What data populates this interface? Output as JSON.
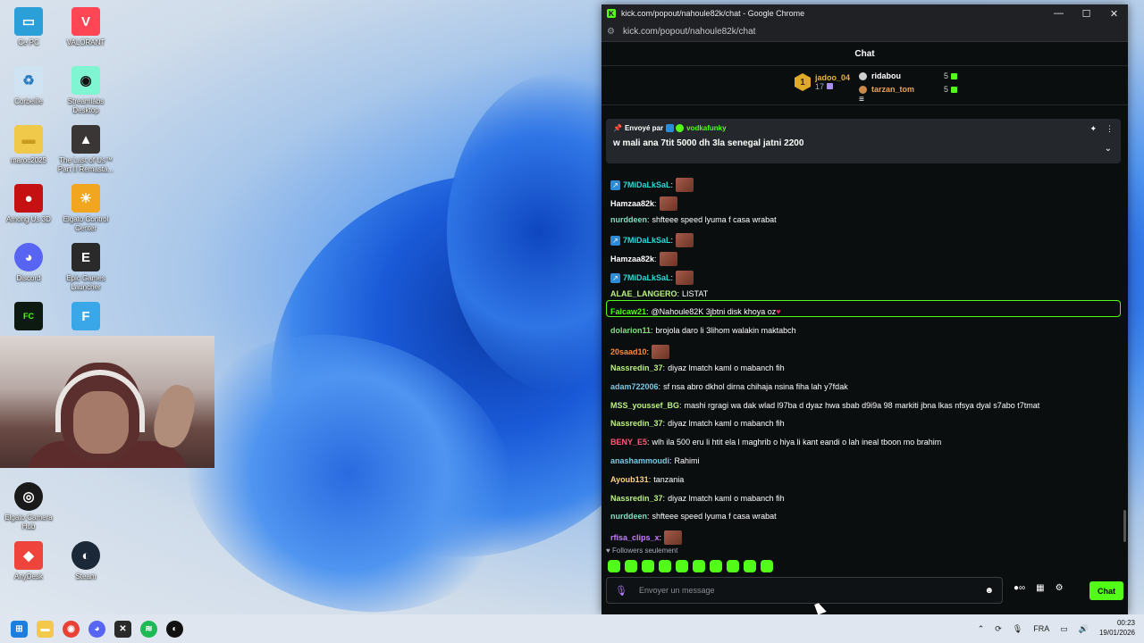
{
  "desktop_icons": [
    {
      "label": "Ce PC",
      "color": "#2a9fd8",
      "glyph": "▭"
    },
    {
      "label": "VALORANT",
      "color": "#ff4655",
      "glyph": "V"
    },
    {
      "label": "Corbeille",
      "color": "#cfe3f3",
      "glyph": "♻"
    },
    {
      "label": "Streamlabs Desktop",
      "color": "#80f5d2",
      "glyph": "◉"
    },
    {
      "label": "maroc2025",
      "color": "#f0c84a",
      "glyph": "▬"
    },
    {
      "label": "The Last of Us™ Part II Remasta...",
      "color": "#3b3636",
      "glyph": "▲"
    },
    {
      "label": "Among Us 3D",
      "color": "#c51111",
      "glyph": "●"
    },
    {
      "label": "Elgato Control Center",
      "color": "#f2a51e",
      "glyph": "☀"
    },
    {
      "label": "Discord",
      "color": "#5865f2",
      "glyph": "◕"
    },
    {
      "label": "Epic Games Launcher",
      "color": "#2a2a2a",
      "glyph": "E"
    },
    {
      "label": "Elgato Camera Hub",
      "color": "#1a1a1a",
      "glyph": "◎"
    },
    {
      "label": "AnyDesk",
      "color": "#ef443b",
      "glyph": "◆"
    },
    {
      "label": "Steam",
      "color": "#1b2838",
      "glyph": "◐"
    }
  ],
  "browser": {
    "title": "kick.com/popout/nahoule82k/chat - Google Chrome",
    "url": "kick.com/popout/nahoule82k/chat",
    "minimize": "—",
    "maximize": "☐",
    "close": "✕"
  },
  "chat": {
    "header": "Chat",
    "leaderboard": {
      "first": {
        "rank": "1",
        "name": "jadoo_04",
        "count": "17"
      },
      "second": {
        "name": "ridabou",
        "count": "5"
      },
      "third": {
        "name": "tarzan_tom",
        "count": "5"
      }
    },
    "pinned": {
      "sent_by_label": "Envoyé par",
      "sender": "vodkafunky",
      "message": "w mali ana 7tit 5000 dh 3la senegal jatni 2200"
    },
    "messages": [
      {
        "user": "7MiDaLkSaL",
        "color": "#2bd9d9",
        "text": "",
        "badge": true,
        "emote": true
      },
      {
        "user": "Hamzaa82k",
        "color": "#ffffff",
        "text": "",
        "badge": false,
        "emote": true
      },
      {
        "user": "nurddeen",
        "color": "#7ee0c2",
        "text": "shfteee speed lyuma f casa wrabat",
        "badge": false,
        "emote": false
      },
      {
        "user": "7MiDaLkSaL",
        "color": "#2bd9d9",
        "text": "",
        "badge": true,
        "emote": true
      },
      {
        "user": "Hamzaa82k",
        "color": "#ffffff",
        "text": "",
        "badge": false,
        "emote": true
      },
      {
        "user": "7MiDaLkSaL",
        "color": "#2bd9d9",
        "text": "",
        "badge": true,
        "emote": true
      },
      {
        "user": "ALAE_LANGERO",
        "color": "#b9f27c",
        "text": "LISTAT",
        "badge": false,
        "emote": false
      },
      {
        "user": "Falcaw21",
        "color": "#53fc18",
        "text": "@Nahoule82K 3jbtni disk khoya oz",
        "badge": false,
        "emote": false,
        "heart": true
      },
      {
        "user": "dolarion11",
        "color": "#7ee07e",
        "text": "brojola daro li 3lihom walakin maktabch",
        "badge": false,
        "emote": false
      },
      {
        "user": "20saad10",
        "color": "#ff8a3d",
        "text": "",
        "badge": false,
        "emote": true
      },
      {
        "user": "Nassredin_37",
        "color": "#b9f27c",
        "text": "diyaz lmatch kaml o mabanch fih",
        "badge": false,
        "emote": false
      },
      {
        "user": "adam722006",
        "color": "#7ec8e3",
        "text": "sf nsa abro dkhol dirna chihaja nsina fiha lah y7fdak",
        "badge": false,
        "emote": false
      },
      {
        "user": "MSS_youssef_BG",
        "color": "#b9f27c",
        "text": "mashi rgragi wa dak wlad l97ba d dyaz hwa sbab d9i9a 98 markiti jbna lkas nfsya dyal s7abo t7tmat",
        "badge": false,
        "emote": false
      },
      {
        "user": "Nassredin_37",
        "color": "#b9f27c",
        "text": "diyaz lmatch kaml o mabanch fih",
        "badge": false,
        "emote": false
      },
      {
        "user": "BENY_E5",
        "color": "#ff5a7a",
        "text": "wlh ila 500 eru li htit ela l maghrib o hiya li kant eandi o lah ineal tboon mo brahim",
        "badge": false,
        "emote": false
      },
      {
        "user": "anashammoudi",
        "color": "#7ec8e3",
        "text": "Rahimi",
        "badge": false,
        "emote": false
      },
      {
        "user": "Ayoub131",
        "color": "#ffd27e",
        "text": "tanzania",
        "badge": false,
        "emote": false
      },
      {
        "user": "Nassredin_37",
        "color": "#b9f27c",
        "text": "diyaz lmatch kaml o mabanch fih",
        "badge": false,
        "emote": false
      },
      {
        "user": "nurddeen",
        "color": "#7ee0c2",
        "text": "shfteee speed lyuma f casa wrabat",
        "badge": false,
        "emote": false
      },
      {
        "user": "rfisa_clips_x",
        "color": "#c77dff",
        "text": "",
        "badge": false,
        "emote": true
      }
    ],
    "followers_only": "Followers seulement",
    "input_placeholder": "Envoyer un message",
    "send_label": "Chat"
  },
  "taskbar": {
    "language": "FRA",
    "time": "00:23",
    "date": "19/01/2026"
  }
}
